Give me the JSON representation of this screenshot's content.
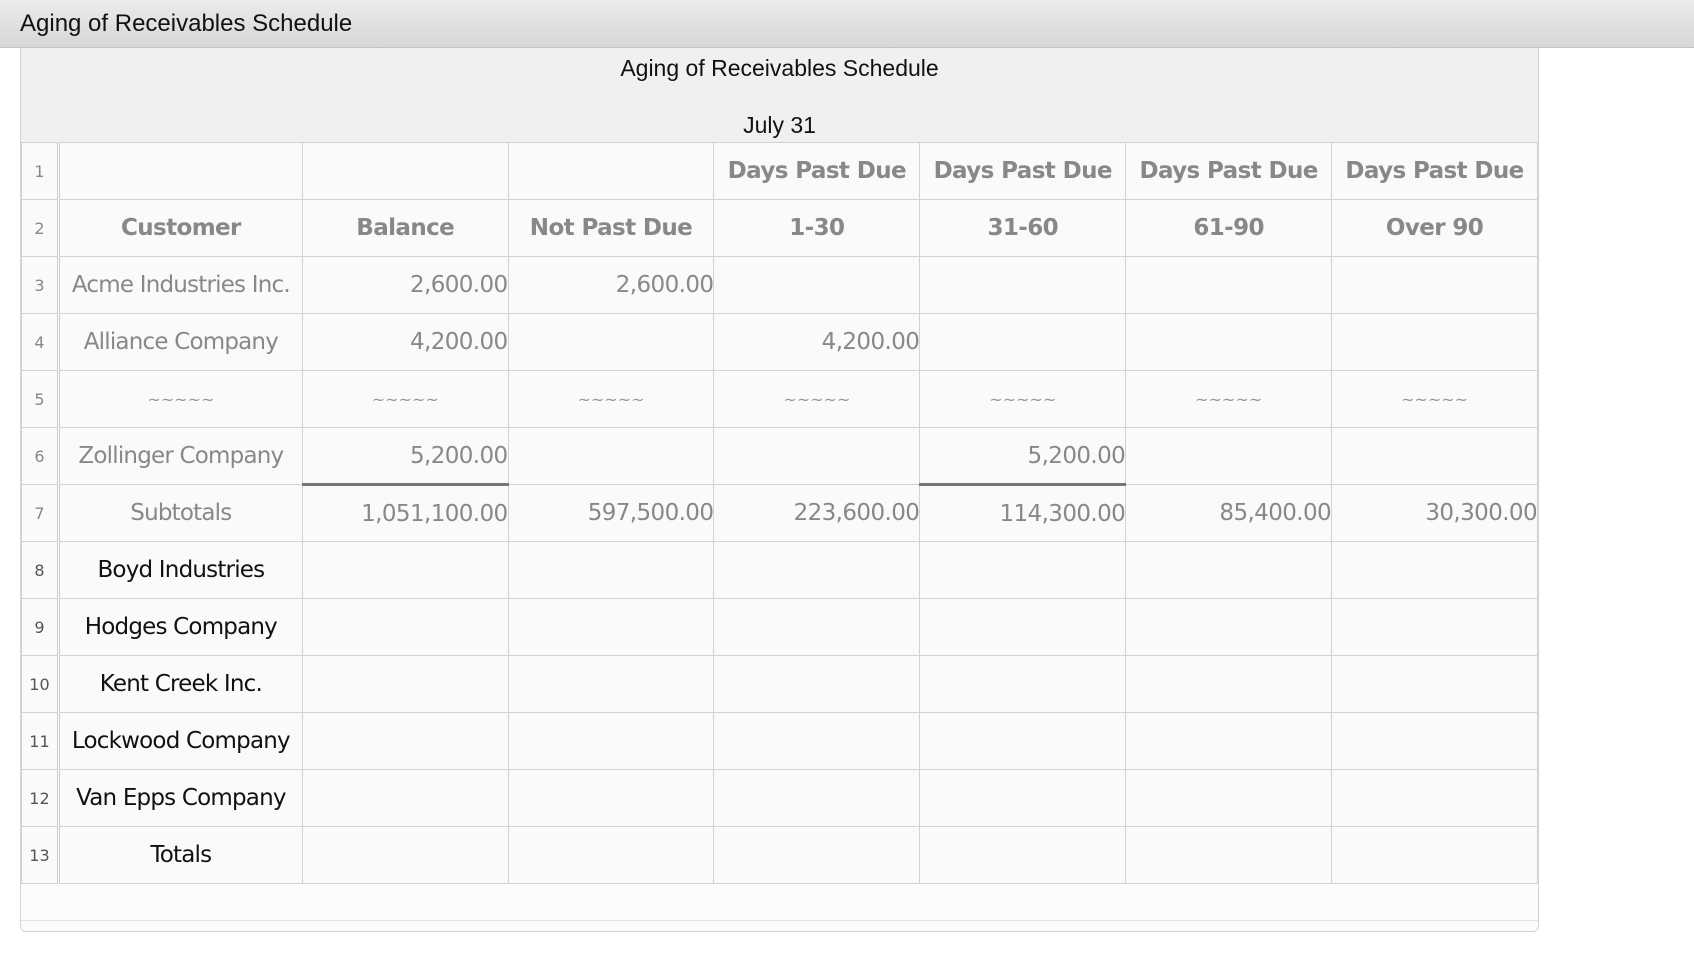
{
  "window": {
    "title": "Aging of Receivables Schedule"
  },
  "schedule": {
    "title": "Aging of Receivables Schedule",
    "date": "July 31"
  },
  "header_row_1": {
    "num": "1",
    "days_past_due": [
      "Days Past Due",
      "Days Past Due",
      "Days Past Due",
      "Days Past Due"
    ]
  },
  "header_row_2": {
    "num": "2",
    "customer": "Customer",
    "balance": "Balance",
    "not_past_due": "Not Past Due",
    "ranges": [
      "1-30",
      "31-60",
      "61-90",
      "Over 90"
    ]
  },
  "rows": [
    {
      "num": "3",
      "customer": "Acme Industries Inc.",
      "balance": "2,600.00",
      "not_past_due": "2,600.00",
      "d1_30": "",
      "d31_60": "",
      "d61_90": "",
      "over90": ""
    },
    {
      "num": "4",
      "customer": "Alliance Company",
      "balance": "4,200.00",
      "not_past_due": "",
      "d1_30": "4,200.00",
      "d31_60": "",
      "d61_90": "",
      "over90": ""
    },
    {
      "num": "5",
      "tilde": "~~~~~"
    },
    {
      "num": "6",
      "customer": "Zollinger Company",
      "balance": "5,200.00",
      "not_past_due": "",
      "d1_30": "",
      "d31_60": "5,200.00",
      "d61_90": "",
      "over90": ""
    },
    {
      "num": "7",
      "customer": "Subtotals",
      "balance": "1,051,100.00",
      "not_past_due": "597,500.00",
      "d1_30": "223,600.00",
      "d31_60": "114,300.00",
      "d61_90": "85,400.00",
      "over90": "30,300.00"
    },
    {
      "num": "8",
      "customer": "Boyd Industries"
    },
    {
      "num": "9",
      "customer": "Hodges Company"
    },
    {
      "num": "10",
      "customer": "Kent Creek Inc."
    },
    {
      "num": "11",
      "customer": "Lockwood Company"
    },
    {
      "num": "12",
      "customer": "Van Epps Company"
    },
    {
      "num": "13",
      "customer": "Totals"
    }
  ]
}
